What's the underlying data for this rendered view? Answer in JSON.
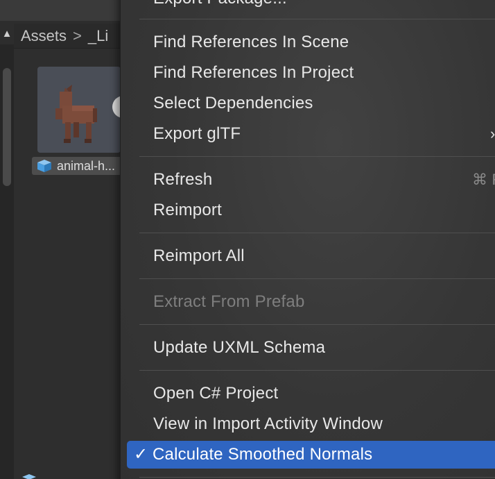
{
  "project_panel": {
    "breadcrumb": {
      "root": "Assets",
      "separator": ">",
      "child": "_Li"
    },
    "asset": {
      "label": "animal-h..."
    },
    "scroll_up_glyph": "▲"
  },
  "context_menu": {
    "items": [
      {
        "label": "Export Package..."
      },
      {
        "label": "Find References In Scene"
      },
      {
        "label": "Find References In Project"
      },
      {
        "label": "Select Dependencies"
      },
      {
        "label": "Export glTF",
        "submenu_glyph": "›"
      },
      {
        "label": "Refresh",
        "shortcut": "⌘ R"
      },
      {
        "label": "Reimport"
      },
      {
        "label": "Reimport All"
      },
      {
        "label": "Extract From Prefab",
        "disabled": true
      },
      {
        "label": "Update UXML Schema"
      },
      {
        "label": "Open C# Project"
      },
      {
        "label": "View in Import Activity Window"
      },
      {
        "label": "Calculate Smoothed Normals",
        "checked": true,
        "check_glyph": "✓"
      }
    ]
  },
  "colors": {
    "menu_background": "#363636",
    "selection": "#2f65c1",
    "disabled_text": "#7e7e7e",
    "panel_background": "#2d2d2d",
    "cube_icon": "#4a9ee0",
    "horse_model": "#7a4a3a"
  },
  "icons": [
    "cube-icon",
    "chevron-right-icon",
    "checkmark-icon",
    "arrow-up-icon"
  ]
}
